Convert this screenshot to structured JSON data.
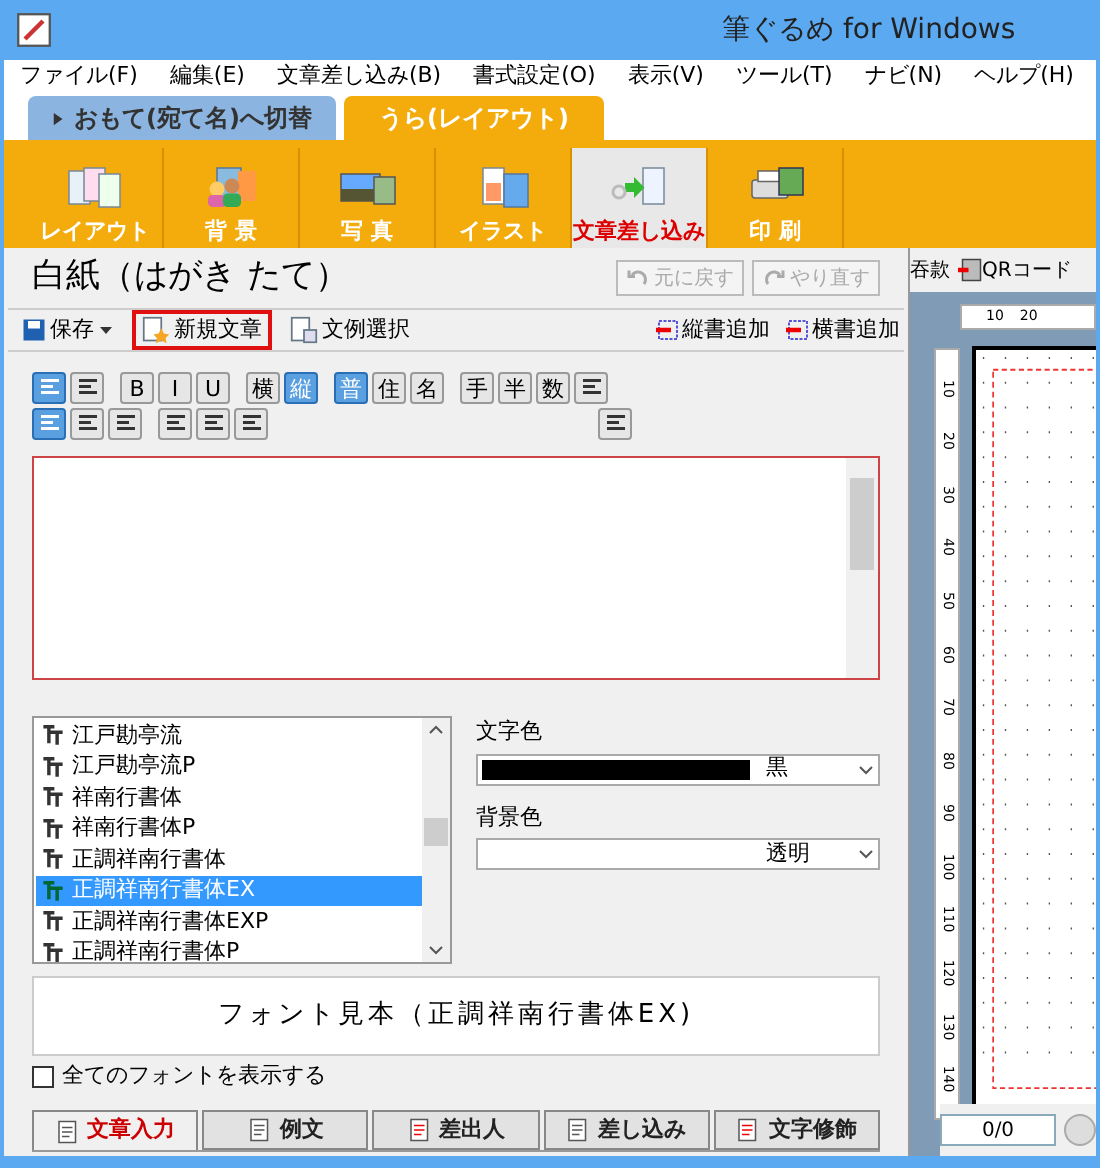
{
  "window": {
    "title": "筆ぐるめ for Windows"
  },
  "menu": [
    "ファイル(F)",
    "編集(E)",
    "文章差し込み(B)",
    "書式設定(O)",
    "表示(V)",
    "ツール(T)",
    "ナビ(N)",
    "ヘルプ(H)"
  ],
  "face_tabs": [
    {
      "label": "おもて(宛て名)へ切替",
      "selected": false
    },
    {
      "label": "うら(レイアウト)",
      "selected": true
    }
  ],
  "toolbar": [
    {
      "label": "レイアウト",
      "selected": false
    },
    {
      "label": "背 景",
      "selected": false
    },
    {
      "label": "写 真",
      "selected": false
    },
    {
      "label": "イラスト",
      "selected": false
    },
    {
      "label": "文章差し込み",
      "selected": true
    },
    {
      "label": "印 刷",
      "selected": false
    }
  ],
  "document": {
    "title": "白紙（はがき たて）",
    "undo": "元に戻す",
    "redo": "やり直す"
  },
  "actions": {
    "left": [
      {
        "label": "保存",
        "kind": "save"
      },
      {
        "label": "新規文章",
        "kind": "new",
        "highlighted": true
      },
      {
        "label": "文例選択",
        "kind": "example",
        "highlighted": false
      }
    ],
    "right": [
      {
        "label": "縦書追加"
      },
      {
        "label": "横書追加"
      }
    ]
  },
  "format_rows": [
    [
      [
        {
          "kind": "icon",
          "selected": true
        },
        {
          "kind": "icon",
          "selected": false
        }
      ],
      [
        {
          "kind": "text",
          "label": "B",
          "selected": false
        },
        {
          "kind": "text",
          "label": "I",
          "selected": false
        },
        {
          "kind": "text",
          "label": "U",
          "selected": false
        }
      ],
      [
        {
          "kind": "text",
          "label": "横",
          "selected": false
        },
        {
          "kind": "text",
          "label": "縦",
          "selected": true
        }
      ],
      [
        {
          "kind": "text",
          "label": "普",
          "selected": true
        },
        {
          "kind": "text",
          "label": "住",
          "selected": false
        },
        {
          "kind": "text",
          "label": "名",
          "selected": false
        }
      ],
      [
        {
          "kind": "text",
          "label": "手",
          "selected": false
        },
        {
          "kind": "text",
          "label": "半",
          "selected": false
        },
        {
          "kind": "text",
          "label": "数",
          "selected": false
        },
        {
          "kind": "icon",
          "selected": false
        }
      ]
    ],
    [
      [
        {
          "kind": "icon",
          "selected": true
        },
        {
          "kind": "icon",
          "selected": false
        },
        {
          "kind": "icon",
          "selected": false
        }
      ],
      [
        {
          "kind": "icon",
          "selected": false
        },
        {
          "kind": "icon",
          "selected": false
        },
        {
          "kind": "icon",
          "selected": false
        }
      ],
      [
        {
          "kind": "icon",
          "selected": false
        }
      ]
    ]
  ],
  "font_list": [
    {
      "label": "江戸勘亭流",
      "selected": false
    },
    {
      "label": "江戸勘亭流P",
      "selected": false
    },
    {
      "label": "祥南行書体",
      "selected": false
    },
    {
      "label": "祥南行書体P",
      "selected": false
    },
    {
      "label": "正調祥南行書体",
      "selected": false
    },
    {
      "label": "正調祥南行書体EX",
      "selected": true
    },
    {
      "label": "正調祥南行書体EXP",
      "selected": false
    },
    {
      "label": "正調祥南行書体P",
      "selected": false
    }
  ],
  "text_color": {
    "label": "文字色",
    "value": "黒"
  },
  "background_color": {
    "label": "背景色",
    "value": "透明"
  },
  "preview": "フォント見本（正調祥南行書体EX)",
  "show_all_fonts": {
    "label": "全てのフォントを表示する",
    "checked": false
  },
  "bottom_tabs": [
    {
      "label": "文章入力",
      "selected": true
    },
    {
      "label": "例文",
      "selected": false
    },
    {
      "label": "差出人",
      "selected": false
    },
    {
      "label": "差し込み",
      "selected": false
    },
    {
      "label": "文字修飾",
      "selected": false
    }
  ],
  "side": {
    "header_text": "吞款",
    "qr_button": "QRコード",
    "h_ruler": [
      "10",
      "20"
    ],
    "v_ruler": [
      "10",
      "20",
      "30",
      "40",
      "50",
      "60",
      "70",
      "80",
      "90",
      "100",
      "110",
      "120",
      "130",
      "140"
    ],
    "page_counter": "0/0"
  }
}
